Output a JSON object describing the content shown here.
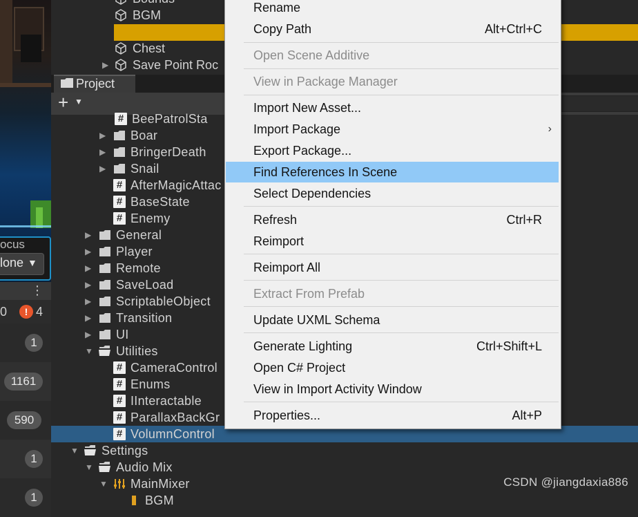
{
  "left_panel": {
    "focus_label": "ocus",
    "done_label": "lone",
    "counts": {
      "errors": "0",
      "warnings": "4"
    },
    "log_counts": [
      "1",
      "1161",
      "590",
      "1",
      "1"
    ]
  },
  "hierarchy": {
    "items": [
      {
        "label": "Bounds"
      },
      {
        "label": "BGM"
      },
      {
        "label": ""
      },
      {
        "label": "Chest"
      },
      {
        "label": "Save Point Roc"
      }
    ]
  },
  "project": {
    "tab_label": "Project",
    "tree": [
      {
        "label": "BeePatrolSta",
        "icon": "script"
      },
      {
        "label": "Boar",
        "icon": "folder"
      },
      {
        "label": "BringerDeath",
        "icon": "folder"
      },
      {
        "label": "Snail",
        "icon": "folder"
      },
      {
        "label": "AfterMagicAttac",
        "icon": "script"
      },
      {
        "label": "BaseState",
        "icon": "script"
      },
      {
        "label": "Enemy",
        "icon": "script"
      },
      {
        "label": "General",
        "icon": "folder"
      },
      {
        "label": "Player",
        "icon": "folder"
      },
      {
        "label": "Remote",
        "icon": "folder"
      },
      {
        "label": "SaveLoad",
        "icon": "folder"
      },
      {
        "label": "ScriptableObject",
        "icon": "folder"
      },
      {
        "label": "Transition",
        "icon": "folder"
      },
      {
        "label": "UI",
        "icon": "folder"
      },
      {
        "label": "Utilities",
        "icon": "folder-open"
      },
      {
        "label": "CameraControl",
        "icon": "script"
      },
      {
        "label": "Enums",
        "icon": "script"
      },
      {
        "label": "IInteractable",
        "icon": "script"
      },
      {
        "label": "ParallaxBackGr",
        "icon": "script"
      },
      {
        "label": "VolumnControl",
        "icon": "script",
        "selected": true
      },
      {
        "label": "Settings",
        "icon": "folder-open"
      },
      {
        "label": "Audio Mix",
        "icon": "folder-open"
      },
      {
        "label": "MainMixer",
        "icon": "mixer"
      },
      {
        "label": "BGM",
        "icon": "mixer-group"
      }
    ]
  },
  "context_menu": {
    "items": [
      {
        "label": "Rename",
        "shortcut": ""
      },
      {
        "label": "Copy Path",
        "shortcut": "Alt+Ctrl+C"
      },
      {
        "label": "Open Scene Additive",
        "shortcut": "",
        "disabled": true
      },
      {
        "label": "View in Package Manager",
        "shortcut": "",
        "disabled": true
      },
      {
        "label": "Import New Asset...",
        "shortcut": ""
      },
      {
        "label": "Import Package",
        "shortcut": "",
        "submenu": true
      },
      {
        "label": "Export Package...",
        "shortcut": ""
      },
      {
        "label": "Find References In Scene",
        "shortcut": "",
        "highlighted": true
      },
      {
        "label": "Select Dependencies",
        "shortcut": ""
      },
      {
        "label": "Refresh",
        "shortcut": "Ctrl+R"
      },
      {
        "label": "Reimport",
        "shortcut": ""
      },
      {
        "label": "Reimport All",
        "shortcut": ""
      },
      {
        "label": "Extract From Prefab",
        "shortcut": "",
        "disabled": true
      },
      {
        "label": "Update UXML Schema",
        "shortcut": ""
      },
      {
        "label": "Generate Lighting",
        "shortcut": "Ctrl+Shift+L"
      },
      {
        "label": "Open C# Project",
        "shortcut": ""
      },
      {
        "label": "View in Import Activity Window",
        "shortcut": ""
      },
      {
        "label": "Properties...",
        "shortcut": "Alt+P"
      }
    ]
  },
  "watermark": "CSDN @jiangdaxia886",
  "colors": {
    "selection_blue": "#2c5d87",
    "hierarchy_highlight": "#d7a000",
    "menu_highlight": "#91c9f7",
    "warning_orange": "#e8562c"
  }
}
